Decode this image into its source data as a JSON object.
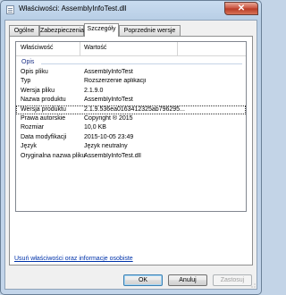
{
  "window": {
    "title": "Właściwości: AssemblyInfoTest.dll",
    "close_label": "✕"
  },
  "tabs": [
    {
      "label": "Ogólne"
    },
    {
      "label": "Zabezpieczenia"
    },
    {
      "label": "Szczegóły"
    },
    {
      "label": "Poprzednie wersje"
    }
  ],
  "details": {
    "columns": {
      "property": "Właściwość",
      "value": "Wartość"
    },
    "group": "Opis",
    "rows": [
      {
        "name": "Opis pliku",
        "value": "AssemblyInfoTest"
      },
      {
        "name": "Typ",
        "value": "Rozszerzenie aplikacji"
      },
      {
        "name": "Wersja pliku",
        "value": "2.1.9.0"
      },
      {
        "name": "Nazwa produktu",
        "value": "AssemblyInfoTest"
      },
      {
        "name": "Wersja produktu",
        "value": "2.1.9.536ea0163412325ab796295..."
      },
      {
        "name": "Prawa autorskie",
        "value": "Copyright ® 2015"
      },
      {
        "name": "Rozmiar",
        "value": "10,0 KB"
      },
      {
        "name": "Data modyfikacji",
        "value": "2015-10-05 23:49"
      },
      {
        "name": "Język",
        "value": "Język neutralny"
      },
      {
        "name": "Oryginalna nazwa pliku",
        "value": "AssemblyInfoTest.dll"
      }
    ]
  },
  "remove_link": "Usuń właściwości oraz informacje osobiste",
  "buttons": {
    "ok": "OK",
    "cancel": "Anuluj",
    "apply": "Zastosuj"
  }
}
